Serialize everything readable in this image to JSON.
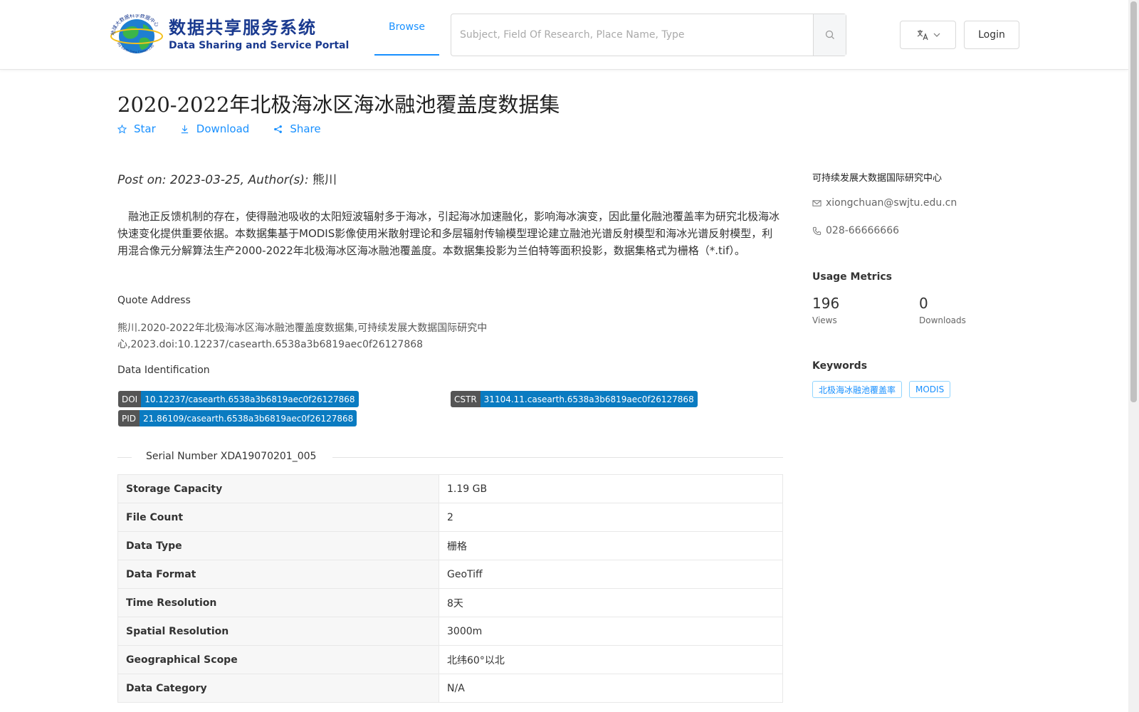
{
  "header": {
    "logo": {
      "cn": "数据共享服务系统",
      "en": "Data Sharing and Service Portal",
      "ring_text": "地球大数据科学数据中心",
      "ring_text_en": "Big Earth Data Center,CAS"
    },
    "nav": {
      "browse": "Browse"
    },
    "search": {
      "placeholder": "Subject, Field Of Research, Place Name, Type"
    },
    "login": "Login"
  },
  "dataset": {
    "title": "2020-2022年北极海冰区海冰融池覆盖度数据集",
    "actions": {
      "star": "Star",
      "download": "Download",
      "share": "Share"
    },
    "post": {
      "prefix": "Post on: 2023-03-25, Author(s): ",
      "author": "熊川"
    },
    "description": "融池正反馈机制的存在，使得融池吸收的太阳短波辐射多于海冰，引起海冰加速融化，影响海冰演变，因此量化融池覆盖率为研究北极海冰快速变化提供重要依据。本数据集基于MODIS影像使用米散射理论和多层辐射传输模型理论建立融池光谱反射模型和海冰光谱反射模型，利用混合像元分解算法生产2000-2022年北极海冰区海冰融池覆盖度。本数据集投影为兰伯特等面积投影，数据集格式为栅格（*.tif）。",
    "quote": {
      "label": "Quote Address",
      "text": "熊川.2020-2022年北极海冰区海冰融池覆盖度数据集,可持续发展大数据国际研究中心,2023.doi:10.12237/casearth.6538a3b6819aec0f26127868"
    },
    "identification": {
      "label": "Data Identification",
      "doi": {
        "key": "DOI",
        "value": "10.12237/casearth.6538a3b6819aec0f26127868"
      },
      "cstr": {
        "key": "CSTR",
        "value": "31104.11.casearth.6538a3b6819aec0f26127868"
      },
      "pid": {
        "key": "PID",
        "value": "21.86109/casearth.6538a3b6819aec0f26127868"
      }
    },
    "serial": "Serial Number XDA19070201_005",
    "metadata": [
      {
        "key": "Storage Capacity",
        "value": "1.19 GB"
      },
      {
        "key": "File Count",
        "value": "2"
      },
      {
        "key": "Data Type",
        "value": "栅格"
      },
      {
        "key": "Data Format",
        "value": "GeoTiff"
      },
      {
        "key": "Time Resolution",
        "value": "8天"
      },
      {
        "key": "Spatial Resolution",
        "value": "3000m"
      },
      {
        "key": "Geographical Scope",
        "value": "北纬60°以北"
      },
      {
        "key": "Data Category",
        "value": "N/A"
      }
    ]
  },
  "sidebar": {
    "org": "可持续发展大数据国际研究中心",
    "email": "xiongchuan@swjtu.edu.cn",
    "phone": "028-66666666",
    "usage": {
      "title": "Usage Metrics",
      "views": "196",
      "views_label": "Views",
      "downloads": "0",
      "downloads_label": "Downloads"
    },
    "keywords": {
      "title": "Keywords",
      "items": [
        "北极海冰融池覆盖率",
        "MODIS"
      ]
    }
  },
  "colors": {
    "accent": "#1890ff",
    "badge_key": "#555555",
    "badge_value": "#0a7bc1",
    "logo_blue": "#1a3a8f"
  }
}
